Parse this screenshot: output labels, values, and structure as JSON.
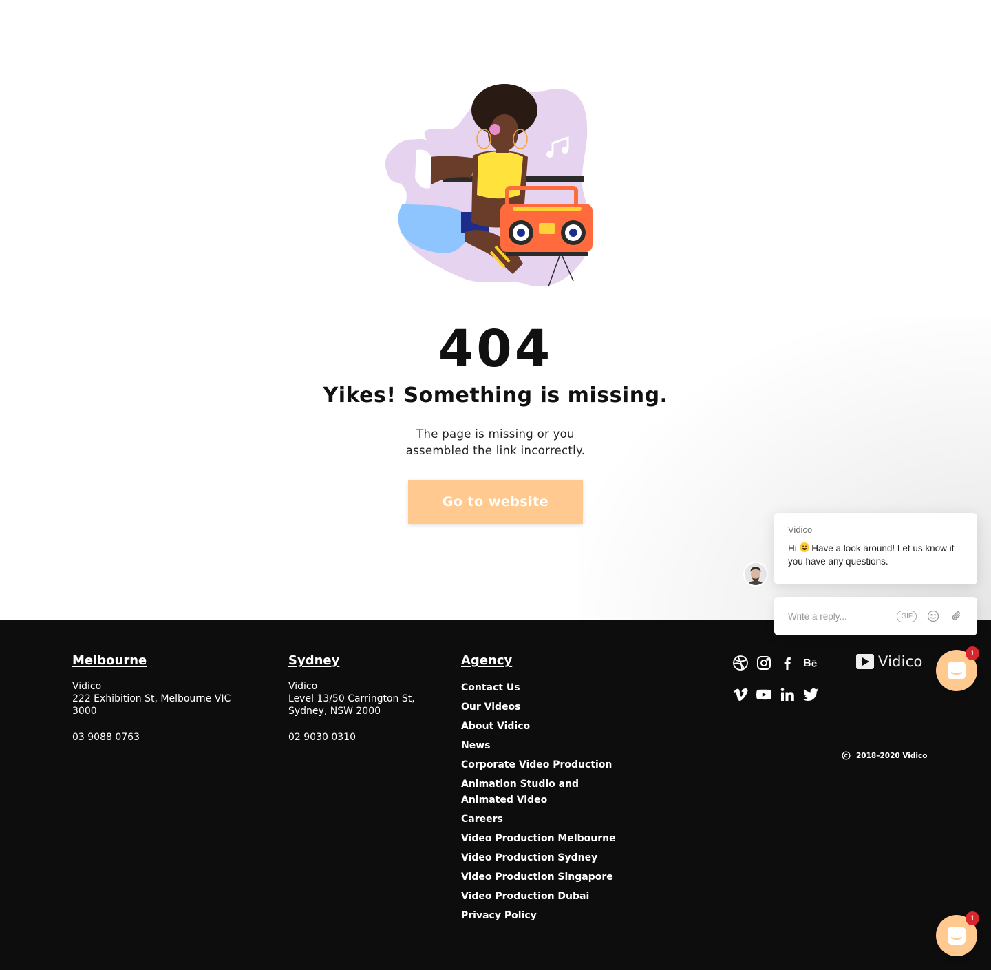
{
  "error": {
    "code": "404",
    "title": "Yikes! Something is missing.",
    "description": "The page is missing or you assembled the link incorrectly.",
    "button_label": "Go to website"
  },
  "footer": {
    "melbourne": {
      "heading": "Melbourne",
      "company": "Vidico",
      "address": "222 Exhibition St, Melbourne VIC 3000",
      "phone": "03 9088 0763"
    },
    "sydney": {
      "heading": "Sydney",
      "company": "Vidico",
      "address": "Level 13/50 Carrington St, Sydney, NSW 2000",
      "phone": "02 9030 0310"
    },
    "agency": {
      "heading": "Agency",
      "links": [
        "Contact Us",
        "Our Videos",
        "About Vidico",
        "News",
        "Corporate Video Production",
        "Animation Studio and Animated Video",
        "Careers",
        "Video Production Melbourne",
        "Video Production Sydney",
        "Video Production Singapore",
        "Video Production Dubai",
        "Privacy Policy"
      ]
    },
    "social_icons": [
      "dribbble-icon",
      "instagram-icon",
      "facebook-icon",
      "behance-icon",
      "vimeo-icon",
      "youtube-icon",
      "linkedin-icon",
      "twitter-icon"
    ],
    "brand_name": "Vidico",
    "copyright": "2018–2020 Vidico"
  },
  "chat": {
    "sender": "Vidico",
    "message_greeting": "Hi",
    "message_body": "Have a look around! Let us know if you have any questions.",
    "reply_placeholder": "Write a reply...",
    "gif_label": "GIF",
    "badge_count": "1"
  },
  "colors": {
    "accent": "#ffc98f",
    "footer_bg": "#0d0d0d",
    "badge": "#d8262f",
    "blob": "#e6d3ef"
  }
}
